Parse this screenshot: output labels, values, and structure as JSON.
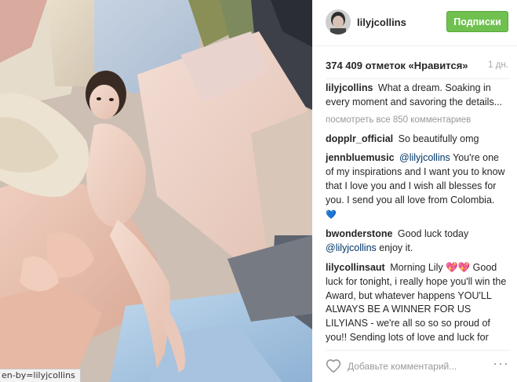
{
  "post": {
    "username": "lilyjcollins",
    "follow_label": "Подписки",
    "likes_text": "374 409 отметок «Нравится»",
    "time": "1 дн.",
    "view_all": "посмотреть все 850 комментариев",
    "comment_placeholder": "Добавьте комментарий...",
    "more_label": "···"
  },
  "comments": [
    {
      "author": "lilyjcollins",
      "text": "What a dream. Soaking in every moment and savoring the details..."
    },
    {
      "author": "dopplr_official",
      "text": "So beautifully omg"
    },
    {
      "author": "jennbluemusic",
      "mention": "@lilyjcollins",
      "text": "You're one of my inspirations and I want you to know that I love you and I wish all blesses for you. I send you all love from Colombia.",
      "emoji": "💙"
    },
    {
      "author": "bwonderstone",
      "text": "Good luck today",
      "mention_after": "@lilyjcollins",
      "text_after": "enjoy it."
    },
    {
      "author": "lilycollinsaut",
      "text": "Morning Lily 💖💖 Good luck for tonight, i really hope you'll win the Award, but whatever happens YOU'LL ALWAYS BE A WINNER FOR US LILYIANS - we're all so so so proud of you!! Sending lots of love and luck for tonight, enjoy the day to the fullest, bc you know this is just the beginning of a great future, i'm sure of it!!! 😲😲😲😲💖💖"
    }
  ],
  "status_bar": {
    "url_text": "en-by=lilyjcollins"
  },
  "colors": {
    "follow_green": "#70c050",
    "mention_blue": "#003569",
    "muted_gray": "#999999"
  },
  "icons": {
    "heart": "heart-icon",
    "more": "more-options-icon"
  }
}
